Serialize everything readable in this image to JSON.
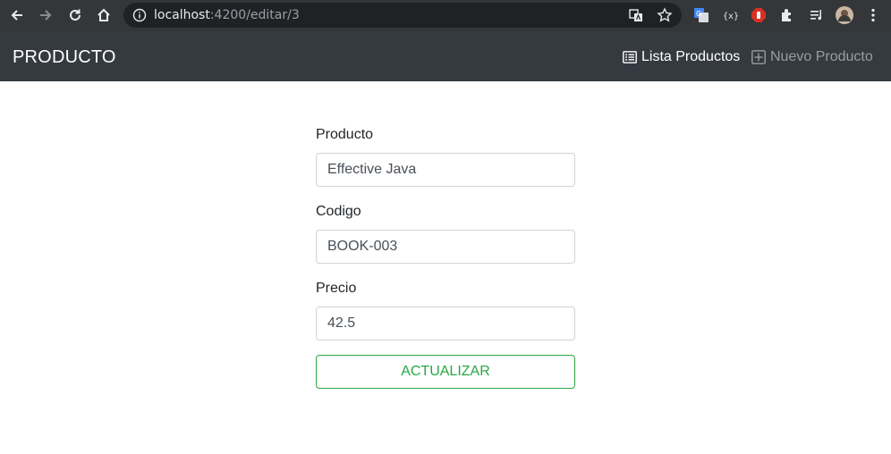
{
  "browser": {
    "url_host": "localhost",
    "url_path": ":4200/editar/3"
  },
  "navbar": {
    "brand": "PRODUCTO",
    "links": [
      {
        "label": "Lista Productos",
        "icon": "list-icon",
        "active": true
      },
      {
        "label": "Nuevo Producto",
        "icon": "plus-square-icon",
        "active": false
      }
    ]
  },
  "form": {
    "fields": [
      {
        "label": "Producto",
        "value": "Effective Java"
      },
      {
        "label": "Codigo",
        "value": "BOOK-003"
      },
      {
        "label": "Precio",
        "value": "42.5"
      }
    ],
    "submit_label": "ACTUALIZAR"
  },
  "colors": {
    "navbar_bg": "#343a40",
    "success": "#28a745",
    "chrome_bg": "#35363a"
  }
}
